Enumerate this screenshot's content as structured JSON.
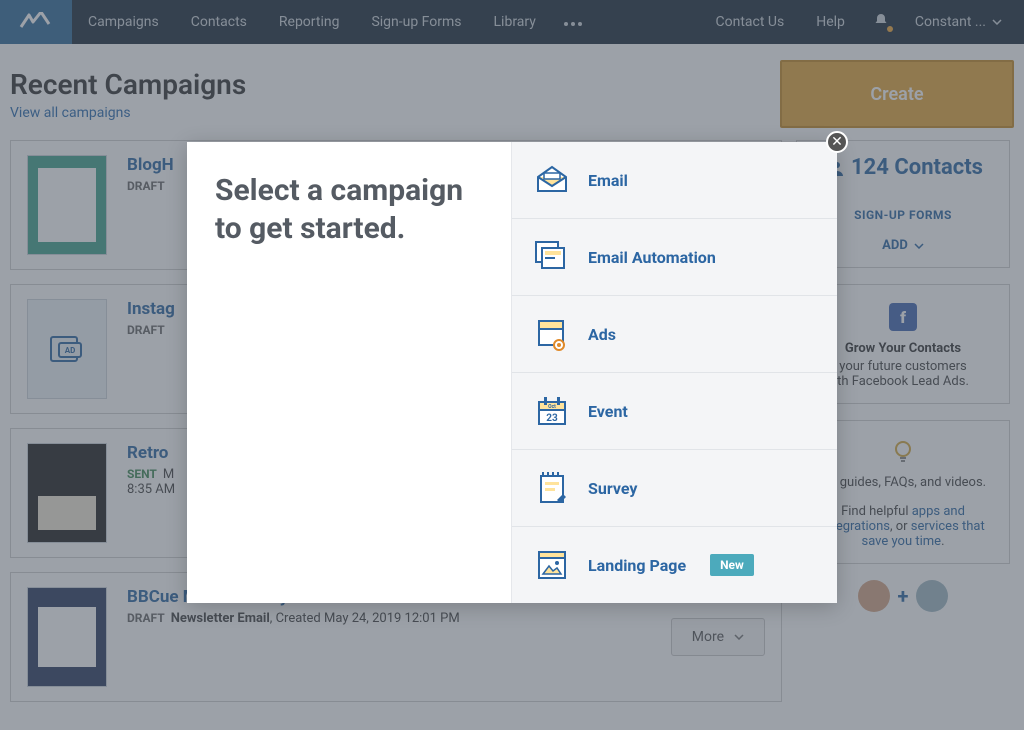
{
  "nav": {
    "items": [
      "Campaigns",
      "Contacts",
      "Reporting",
      "Sign-up Forms",
      "Library"
    ],
    "contact": "Contact Us",
    "help": "Help",
    "user": "Constant ..."
  },
  "page": {
    "title": "Recent Campaigns",
    "view_all": "View all campaigns",
    "create": "Create"
  },
  "campaigns": [
    {
      "title": "BlogH",
      "badge": "DRAFT",
      "badge_type": "draft",
      "meta": "",
      "time": "",
      "thumb": "green"
    },
    {
      "title": "Instag",
      "badge": "DRAFT",
      "badge_type": "draft",
      "meta": "",
      "time": "",
      "thumb": "ad"
    },
    {
      "title": "Retro",
      "badge": "SENT",
      "badge_type": "sent",
      "meta": "M",
      "time": "8:35 AM",
      "thumb": "dark"
    },
    {
      "title": "BBCue Memorial Day",
      "badge": "DRAFT",
      "badge_type": "draft",
      "meta": "Newsletter Email",
      "created": ", Created May 24, 2019 12:01 PM",
      "time": "",
      "thumb": "patt",
      "more": "More"
    }
  ],
  "sidebar": {
    "contacts_count": "124 Contacts",
    "signup_forms": "SIGN-UP FORMS",
    "add": "ADD",
    "grow_title": "Grow Your Contacts",
    "grow_desc_1": "your future customers",
    "grow_desc_2": "th Facebook Lead Ads.",
    "tips_title": "ew guides, FAQs, and videos.",
    "tips_desc_prefix": "Find helpful ",
    "tips_link1": "apps and integrations",
    "tips_desc_mid": ", or ",
    "tips_link2": "services that save you time",
    "tips_desc_suffix": "."
  },
  "modal": {
    "heading_line1": "Select a campaign",
    "heading_line2": "to get started.",
    "options": [
      {
        "label": "Email",
        "icon": "email"
      },
      {
        "label": "Email Automation",
        "icon": "automation"
      },
      {
        "label": "Ads",
        "icon": "ads"
      },
      {
        "label": "Event",
        "icon": "event"
      },
      {
        "label": "Survey",
        "icon": "survey"
      },
      {
        "label": "Landing Page",
        "icon": "landing",
        "pill": "New"
      }
    ]
  }
}
